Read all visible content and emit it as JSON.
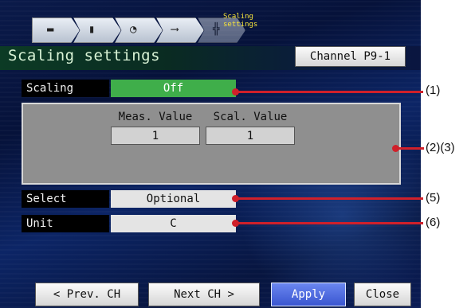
{
  "breadcrumb": {
    "current_label": "Scaling settings",
    "items": [
      {
        "icon": "monitor-icon",
        "glyph": "▬"
      },
      {
        "icon": "meter-bar-icon",
        "glyph": "▮"
      },
      {
        "icon": "dial-icon",
        "glyph": "◔"
      },
      {
        "icon": "probe-icon",
        "glyph": "⟶"
      },
      {
        "icon": "grid-icon",
        "glyph": "╬"
      }
    ]
  },
  "header": {
    "title": "Scaling settings",
    "channel_button_label": "Channel P9-1"
  },
  "form": {
    "scaling": {
      "label": "Scaling",
      "value": "Off"
    },
    "group": {
      "meas_header": "Meas. Value",
      "scal_header": "Scal. Value",
      "meas_value": "1",
      "scal_value": "1"
    },
    "select": {
      "label": "Select",
      "value": "Optional"
    },
    "unit": {
      "label": "Unit",
      "value": "C"
    }
  },
  "footer": {
    "prev_label": "< Prev. CH",
    "next_label": "Next CH >",
    "apply_label": "Apply",
    "close_label": "Close"
  },
  "callouts": {
    "c1": "(1)",
    "c23": "(2)(3)",
    "c5": "(5)",
    "c6": "(6)"
  },
  "colors": {
    "callout": "#d0202a",
    "scaling_on_bg": "#3fae4a",
    "apply_bg": "#4a66e0",
    "screen_bg": "#0a1a4a"
  }
}
